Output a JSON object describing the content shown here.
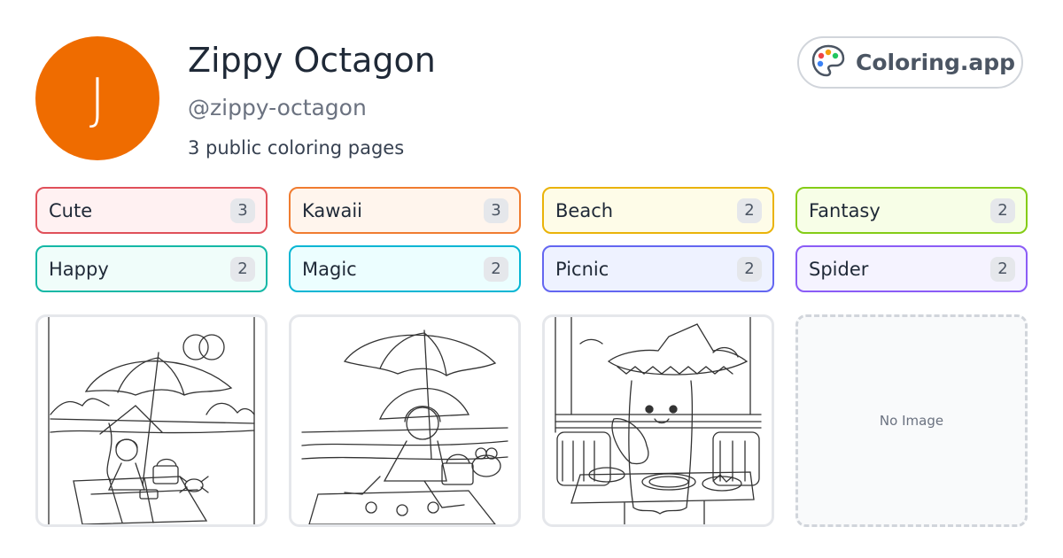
{
  "profile": {
    "avatar_letter": "J",
    "avatar_color": "#ef6c00",
    "name": "Zippy Octagon",
    "handle": "@zippy-octagon",
    "page_count_text": "3 public coloring pages"
  },
  "brand": {
    "label": "Coloring.app",
    "icon": "palette-icon"
  },
  "tags": [
    {
      "label": "Cute",
      "count": "3",
      "border": "#e0505a",
      "bg": "#fff1f2"
    },
    {
      "label": "Kawaii",
      "count": "3",
      "border": "#f07c30",
      "bg": "#fff5ed"
    },
    {
      "label": "Beach",
      "count": "2",
      "border": "#eab308",
      "bg": "#fefce8"
    },
    {
      "label": "Fantasy",
      "count": "2",
      "border": "#84cc16",
      "bg": "#f7fee7"
    },
    {
      "label": "Happy",
      "count": "2",
      "border": "#14b8a6",
      "bg": "#f0fdfa"
    },
    {
      "label": "Magic",
      "count": "2",
      "border": "#06b6d4",
      "bg": "#ecfeff"
    },
    {
      "label": "Picnic",
      "count": "2",
      "border": "#6366f1",
      "bg": "#eef2ff"
    },
    {
      "label": "Spider",
      "count": "2",
      "border": "#8b5cf6",
      "bg": "#f5f3ff"
    }
  ],
  "pages": [
    {
      "subject": "witch-girl-beach-picnic-with-spider"
    },
    {
      "subject": "elf-witch-beach-picnic-with-frog"
    },
    {
      "subject": "sombrero-ghost-eating-burrito"
    },
    {
      "empty_text": "No Image"
    }
  ]
}
